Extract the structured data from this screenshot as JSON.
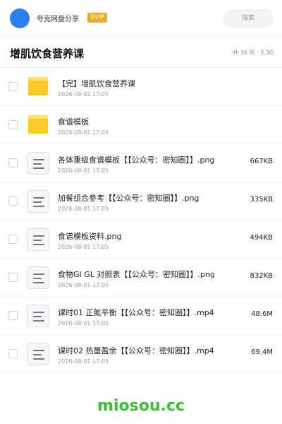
{
  "header": {
    "owner": "夸克网盘分享",
    "badge": "SVIP",
    "search_label": "搜索"
  },
  "title": {
    "text": "增肌饮食营养课",
    "summary": "共 36 项 · 3.3G"
  },
  "items": [
    {
      "name": "【完】增肌饮食营养课",
      "date": "2026-08-01 17:05",
      "size": "",
      "kind": "folder"
    },
    {
      "name": "食谱模板",
      "date": "2026-08-01 17:05",
      "size": "",
      "kind": "folder"
    },
    {
      "name": "各体重级食谱模板【【公众号：密知圈】】.png",
      "date": "2026-08-01 17:05",
      "size": "667KB",
      "kind": "file"
    },
    {
      "name": "加餐组合参考【【公众号：密知圈】】.png",
      "date": "2026-08-01 17:05",
      "size": "335KB",
      "kind": "file"
    },
    {
      "name": "食谱模板资料.png",
      "date": "2026-08-01 17:05",
      "size": "494KB",
      "kind": "file"
    },
    {
      "name": "食物GI GL 对照表【【公众号：密知圈】】.png",
      "date": "2026-08-01 17:05",
      "size": "832KB",
      "kind": "file"
    },
    {
      "name": "课时01 正氮平衡【【公众号：密知圈】】.mp4",
      "date": "2026-08-01 17:05",
      "size": "48.6M",
      "kind": "file"
    },
    {
      "name": "课时02 热量盈余【【公众号：密知圈】】.mp4",
      "date": "2026-08-01 17:05",
      "size": "69.4M",
      "kind": "file"
    }
  ],
  "watermark": "miosou.cc",
  "colors": {
    "avatar": "#2f7df6",
    "badge": "#f5a623",
    "folder": "#ffca28",
    "watermark": "#3bbf35"
  }
}
